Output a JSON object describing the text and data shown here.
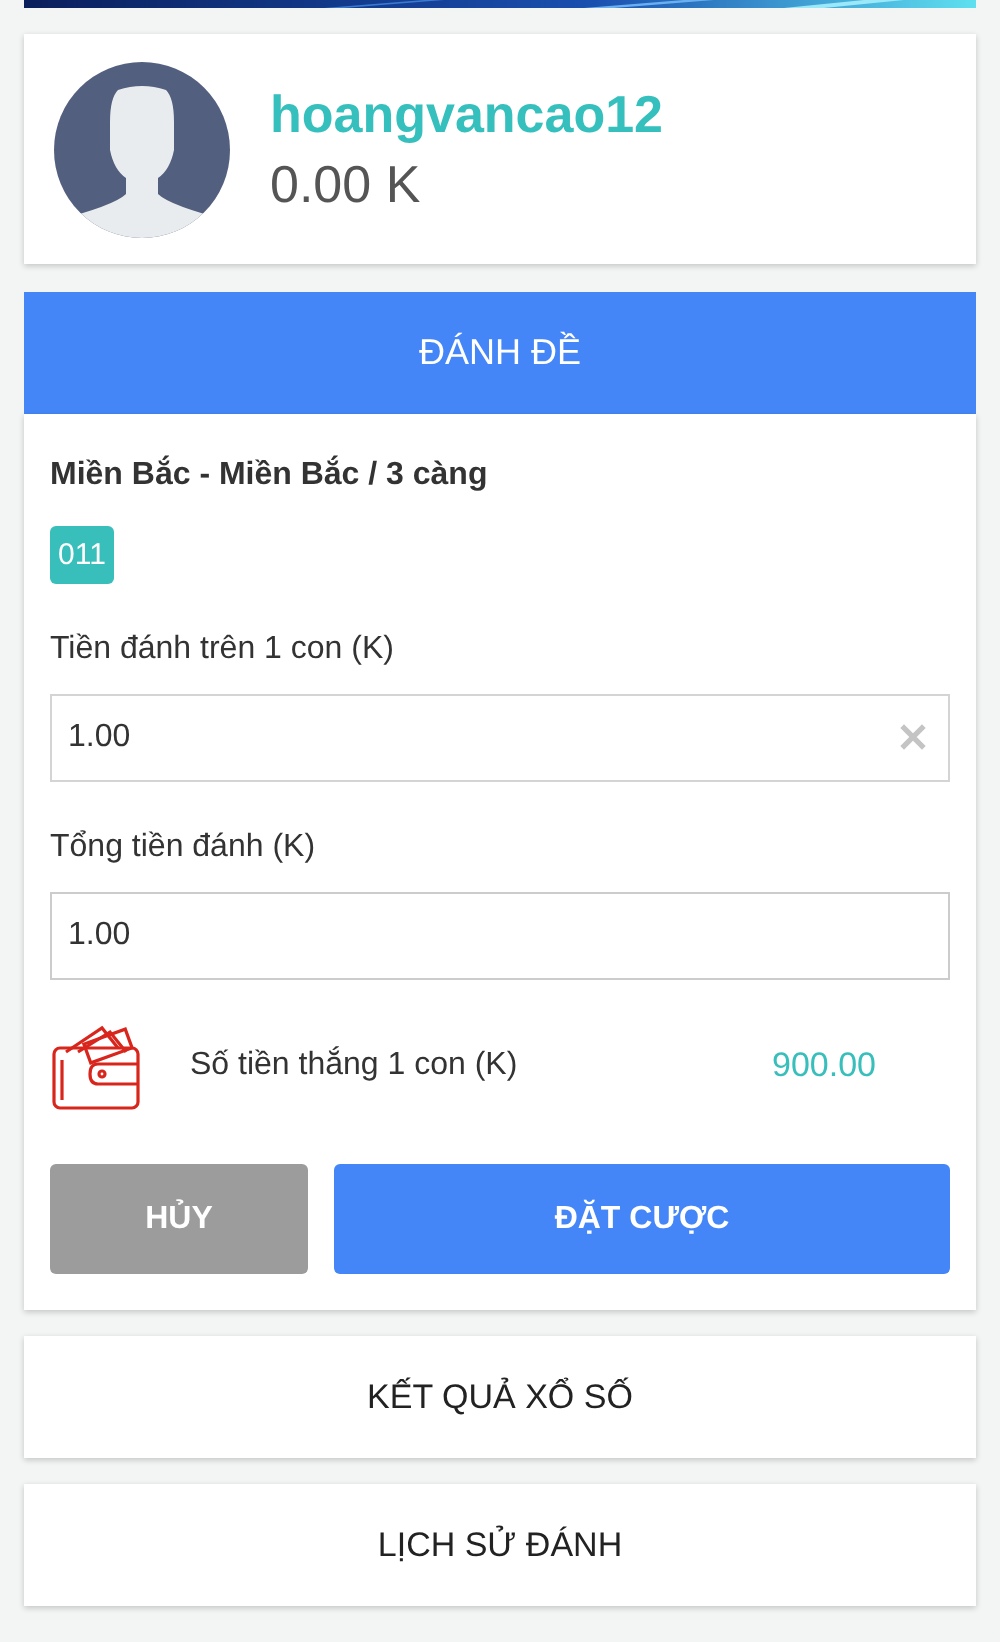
{
  "profile": {
    "username": "hoangvancao12",
    "balance": "0.00 K"
  },
  "bet_panel": {
    "title": "ĐÁNH ĐỀ",
    "game": "Miền Bắc - Miền Bắc / 3 càng",
    "numbers": [
      "011"
    ],
    "fields": [
      {
        "label": "Tiền đánh trên 1 con (K)",
        "value": "1.00",
        "kind": "clearable"
      },
      {
        "label": "Tổng tiền đánh (K)",
        "value": "1.00",
        "kind": "plain"
      }
    ],
    "win_label": "Số tiền thắng 1 con (K)",
    "win_amount": "900.00",
    "buttons": [
      {
        "label": "HỦY",
        "kind": "cancel"
      },
      {
        "label": "ĐẶT CƯỢC",
        "kind": "primary"
      }
    ]
  },
  "links": [
    "KẾT QUẢ XỔ SỐ",
    "LỊCH SỬ ĐÁNH"
  ]
}
